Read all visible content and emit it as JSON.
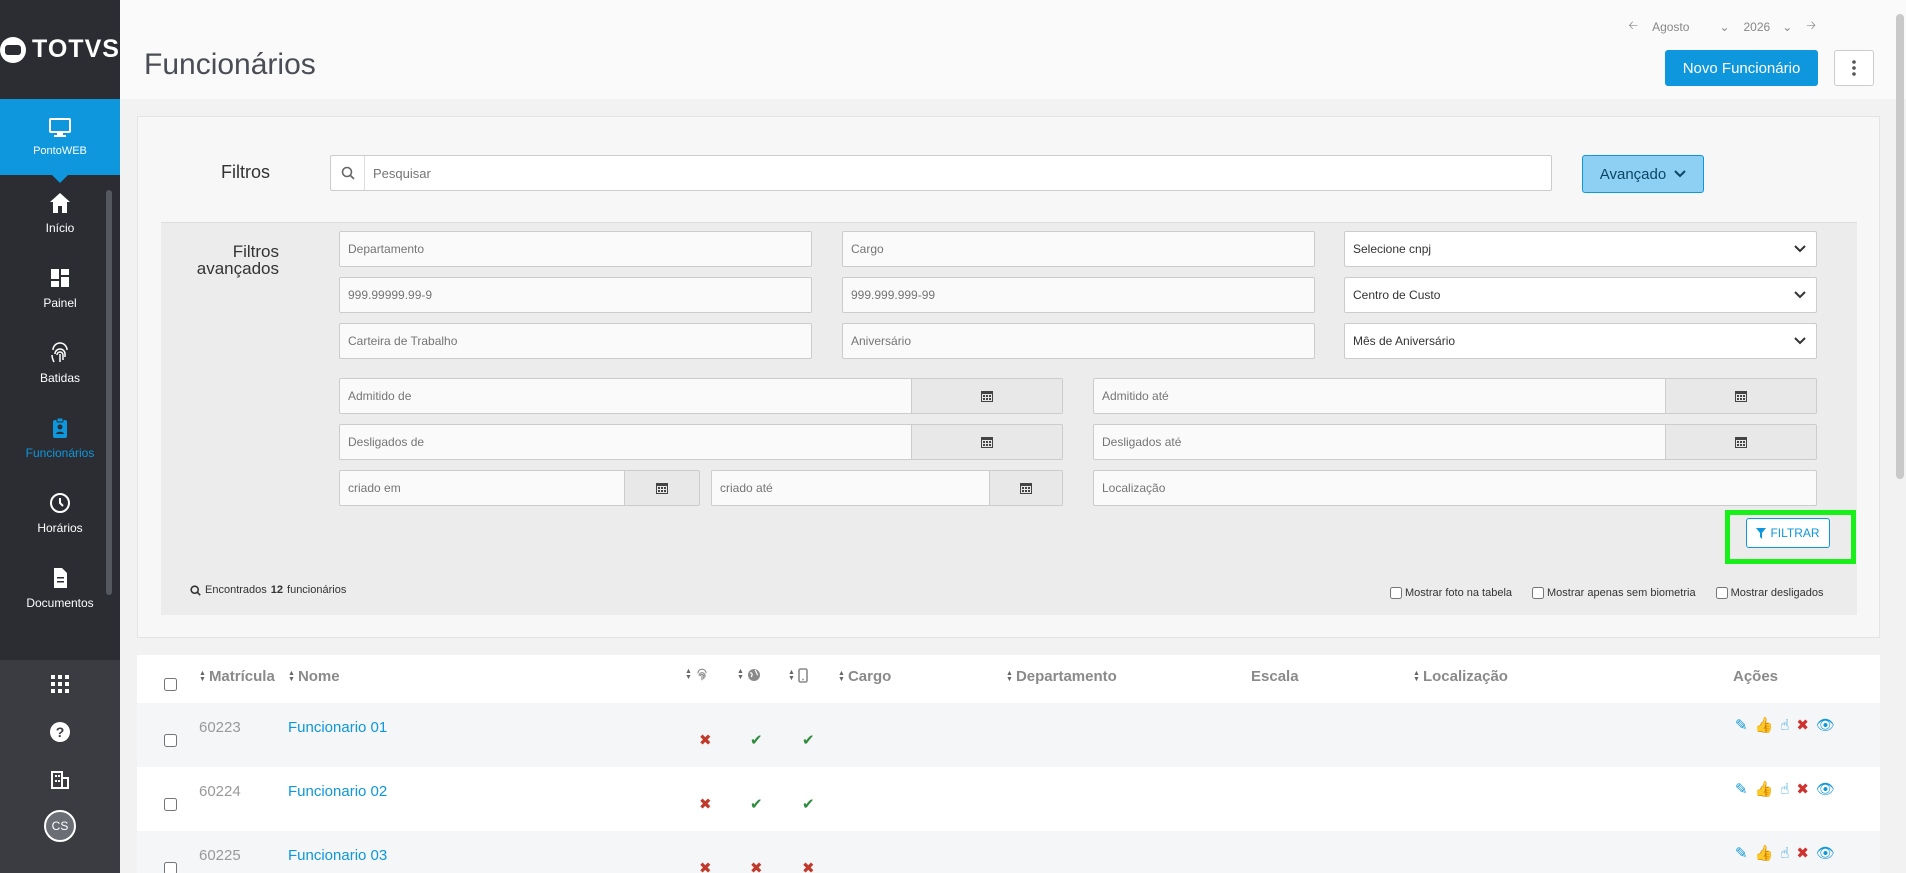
{
  "brand": {
    "name": "TOTVS"
  },
  "sidebar": {
    "active": {
      "label": "PontoWEB",
      "icon": "monitor-icon"
    },
    "items": [
      {
        "label": "Início",
        "icon": "home-icon"
      },
      {
        "label": "Painel",
        "icon": "dashboard-icon"
      },
      {
        "label": "Batidas",
        "icon": "fingerprint-icon"
      },
      {
        "label": "Funcionários",
        "icon": "badge-icon"
      },
      {
        "label": "Horários",
        "icon": "clock-icon"
      },
      {
        "label": "Documentos",
        "icon": "document-icon"
      }
    ],
    "avatar": "CS"
  },
  "header": {
    "title": "Funcionários",
    "month": "Agosto",
    "year": "2026",
    "new_button": "Novo Funcionário"
  },
  "filters": {
    "label": "Filtros",
    "search_placeholder": "Pesquisar",
    "advanced_button": "Avançado",
    "advanced_label": "Filtros avançados",
    "departamento": "Departamento",
    "cargo": "Cargo",
    "cnpj": "Selecione cnpj",
    "pis": "999.99999.99-9",
    "cpf": "999.999.999-99",
    "centro_custo": "Centro de Custo",
    "carteira": "Carteira de Trabalho",
    "aniversario": "Aniversário",
    "mes_aniversario": "Mês de Aniversário",
    "admitido_de": "Admitido de",
    "admitido_ate": "Admitido até",
    "desligados_de": "Desligados de",
    "desligados_ate": "Desligados até",
    "criado_em": "criado em",
    "criado_ate": "criado até",
    "localizacao": "Localização",
    "filtrar": "FILTRAR"
  },
  "results": {
    "prefix": "Encontrados",
    "count": "12",
    "suffix": "funcionários",
    "opt_foto": "Mostrar foto na tabela",
    "opt_biometria": "Mostrar apenas sem biometria",
    "opt_desligados": "Mostrar desligados"
  },
  "table": {
    "columns": {
      "matricula": "Matrícula",
      "nome": "Nome",
      "cargo": "Cargo",
      "departamento": "Departamento",
      "escala": "Escala",
      "localizacao": "Localização",
      "acoes": "Ações"
    },
    "rows": [
      {
        "matricula": "60223",
        "nome": "Funcionario 01",
        "bio": "x",
        "web": "ok",
        "mobile": "ok"
      },
      {
        "matricula": "60224",
        "nome": "Funcionario 02",
        "bio": "x",
        "web": "ok",
        "mobile": "ok"
      },
      {
        "matricula": "60225",
        "nome": "Funcionario 03",
        "bio": "x",
        "web": "x",
        "mobile": "x"
      }
    ]
  },
  "colors": {
    "accent": "#0e97dc",
    "sidebar": "#2b2d33",
    "highlight": "#19f019"
  }
}
